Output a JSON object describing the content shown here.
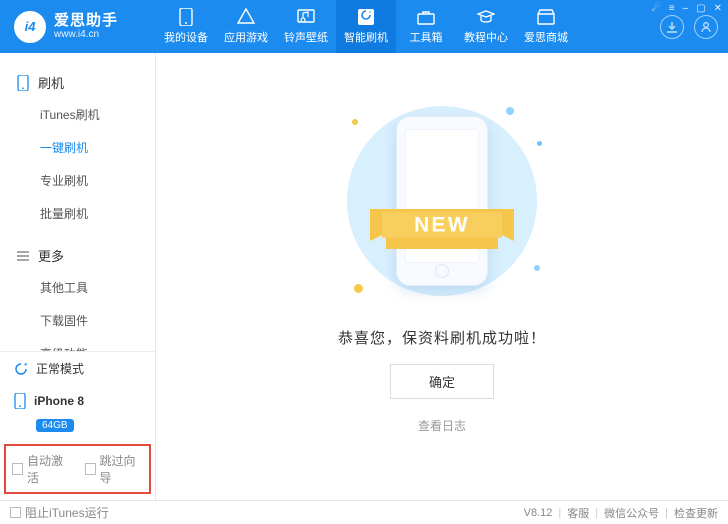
{
  "brand": {
    "name": "爱思助手",
    "domain": "www.i4.cn",
    "logo_text": "i4"
  },
  "win_icons": [
    "shirt",
    "menu",
    "min",
    "max",
    "close"
  ],
  "tabs": [
    {
      "key": "device",
      "label": "我的设备"
    },
    {
      "key": "apps",
      "label": "应用游戏"
    },
    {
      "key": "ring",
      "label": "铃声壁纸"
    },
    {
      "key": "flash",
      "label": "智能刷机",
      "active": true
    },
    {
      "key": "tools",
      "label": "工具箱"
    },
    {
      "key": "tutorial",
      "label": "教程中心"
    },
    {
      "key": "mall",
      "label": "爱思商城"
    }
  ],
  "sidebar": {
    "groups": [
      {
        "title": "刷机",
        "icon": "phone",
        "items": [
          {
            "label": "iTunes刷机"
          },
          {
            "label": "一键刷机",
            "active": true
          },
          {
            "label": "专业刷机"
          },
          {
            "label": "批量刷机"
          }
        ]
      },
      {
        "title": "更多",
        "icon": "list",
        "items": [
          {
            "label": "其他工具"
          },
          {
            "label": "下载固件"
          },
          {
            "label": "高级功能"
          }
        ]
      }
    ],
    "mode": {
      "label": "正常模式"
    },
    "device": {
      "name": "iPhone 8",
      "storage": "64GB"
    },
    "checks": [
      {
        "label": "自动激活"
      },
      {
        "label": "跳过向导"
      }
    ]
  },
  "main": {
    "ribbon_text": "NEW",
    "success_text": "恭喜您，保资料刷机成功啦！",
    "ok_button": "确定",
    "view_log": "查看日志"
  },
  "statusbar": {
    "block_itunes": "阻止iTunes运行",
    "version": "V8.12",
    "links": [
      "客服",
      "微信公众号",
      "检查更新"
    ]
  }
}
